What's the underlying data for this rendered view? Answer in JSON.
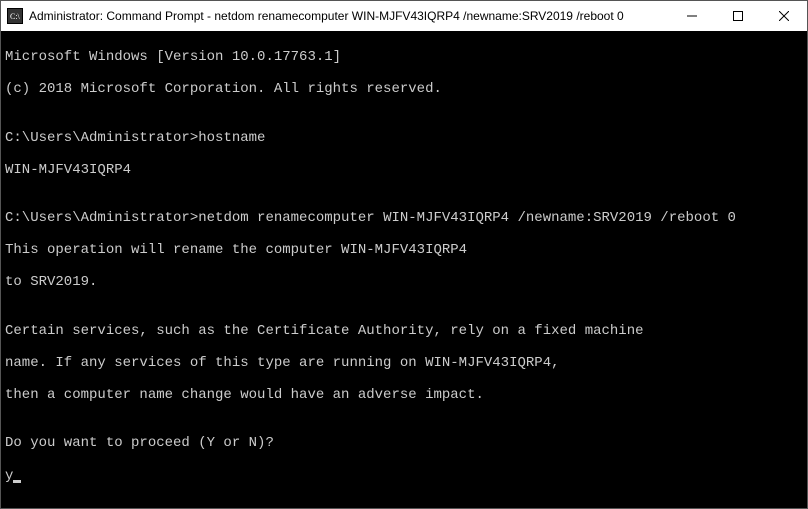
{
  "titlebar": {
    "title": "Administrator: Command Prompt - netdom  renamecomputer WIN-MJFV43IQRP4 /newname:SRV2019 /reboot 0"
  },
  "window_controls": {
    "minimize": "—",
    "maximize": "☐",
    "close": "✕"
  },
  "terminal": {
    "line1": "Microsoft Windows [Version 10.0.17763.1]",
    "line2": "(c) 2018 Microsoft Corporation. All rights reserved.",
    "blank1": "",
    "prompt1_path": "C:\\Users\\Administrator>",
    "prompt1_cmd": "hostname",
    "hostname_output": "WIN-MJFV43IQRP4",
    "blank2": "",
    "prompt2_path": "C:\\Users\\Administrator>",
    "prompt2_cmd": "netdom renamecomputer WIN-MJFV43IQRP4 /newname:SRV2019 /reboot 0",
    "rename_msg1": "This operation will rename the computer WIN-MJFV43IQRP4",
    "rename_msg2": "to SRV2019.",
    "blank3": "",
    "warn1": "Certain services, such as the Certificate Authority, rely on a fixed machine",
    "warn2": "name. If any services of this type are running on WIN-MJFV43IQRP4,",
    "warn3": "then a computer name change would have an adverse impact.",
    "blank4": "",
    "proceed_prompt": "Do you want to proceed (Y or N)?",
    "user_input": "y"
  }
}
